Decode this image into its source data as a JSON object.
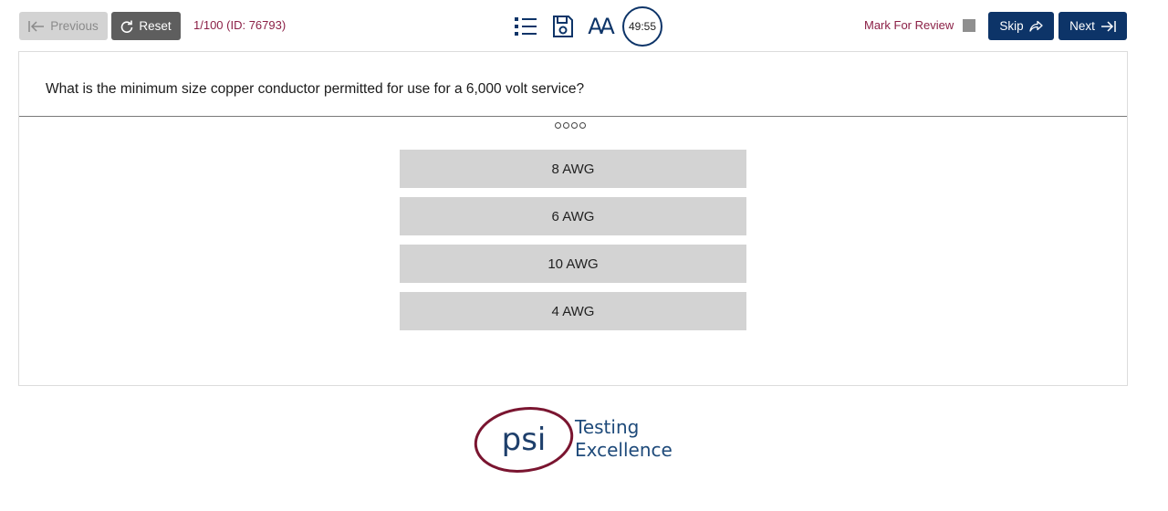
{
  "toolbar": {
    "previous_label": "Previous",
    "reset_label": "Reset",
    "question_counter": "1/100 (ID: 76793)",
    "timer": "49:55",
    "font_tool_label": "AA",
    "mark_for_review_label": "Mark For Review",
    "skip_label": "Skip",
    "next_label": "Next"
  },
  "question": {
    "text": "What is the minimum size copper conductor permitted for use for a 6,000 volt service?",
    "answers": [
      {
        "label": "8 AWG"
      },
      {
        "label": "6 AWG"
      },
      {
        "label": "10 AWG"
      },
      {
        "label": "4 AWG"
      }
    ]
  },
  "footer": {
    "logo_mark": "psi",
    "logo_line1": "Testing",
    "logo_line2": "Excellence"
  },
  "colors": {
    "primary": "#0d3468",
    "accent": "#8b2046",
    "answer_bg": "#d3d3d3",
    "disabled_btn": "#d3d3d3",
    "reset_btn": "#5e5e5e"
  }
}
